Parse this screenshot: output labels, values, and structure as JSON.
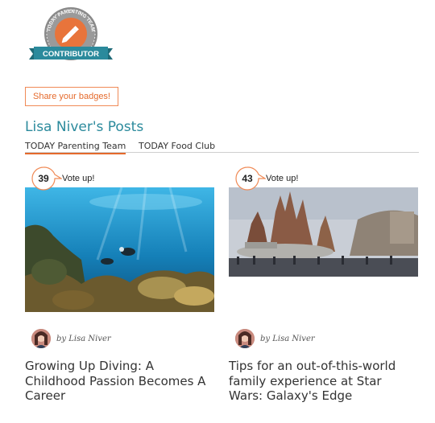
{
  "badge": {
    "arc_text": "TODAY PARENTING TEAM",
    "ribbon_label": "CONTRIBUTOR",
    "icon": "pencil-icon",
    "colors": {
      "ring": "#8a8a8a",
      "center": "#e8743b",
      "ribbon": "#2b8a9c"
    }
  },
  "share_button": {
    "label": "Share your badges!"
  },
  "posts_heading": "Lisa Niver's Posts",
  "tabs": [
    {
      "label": "TODAY Parenting Team",
      "active": true
    },
    {
      "label": "TODAY Food Club",
      "active": false
    }
  ],
  "posts": [
    {
      "votes": "39",
      "vote_label": "Vote up!",
      "image": "underwater-diving-photo",
      "author": "by Lisa Niver",
      "title": "Growing Up Diving: A Childhood Passion Becomes A Career"
    },
    {
      "votes": "43",
      "vote_label": "Vote up!",
      "image": "star-wars-galaxys-edge-photo",
      "author": "by Lisa Niver",
      "title": "Tips for an out-of-this-world family experience at Star Wars: Galaxy's Edge"
    }
  ],
  "colors": {
    "accent": "#e56a2c",
    "heading": "#2b8a9c"
  }
}
